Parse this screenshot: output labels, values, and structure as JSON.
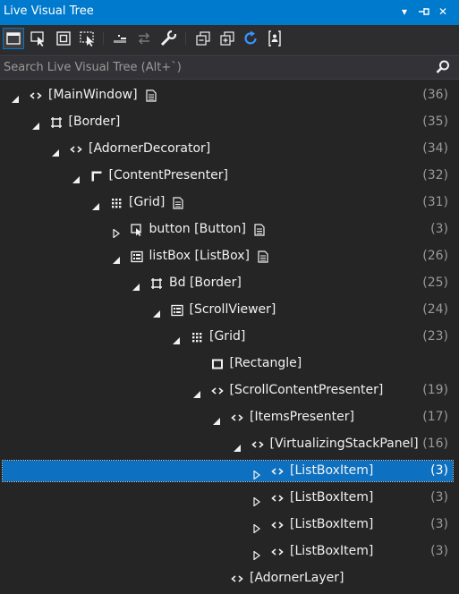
{
  "panel": {
    "title": "Live Visual Tree",
    "colors": {
      "accent": "#007acc",
      "background": "#252526",
      "selected": "#0e70c0",
      "count": "#9a9a9a"
    }
  },
  "titlebar_buttons": [
    {
      "name": "dropdown-icon",
      "glyph": "▾"
    },
    {
      "name": "pin-icon",
      "glyph": "⊣"
    },
    {
      "name": "close-icon",
      "glyph": "✕"
    }
  ],
  "toolbar": [
    {
      "name": "select-in-running-app-icon"
    },
    {
      "name": "select-element-icon"
    },
    {
      "name": "display-layout-adorners-icon"
    },
    {
      "name": "track-focused-element-icon"
    },
    {
      "name": "go-to-live-visual-tree-icon"
    },
    {
      "name": "back-to-source-icon"
    },
    {
      "name": "show-properties-icon"
    },
    {
      "name": "collapse-all-icon"
    },
    {
      "name": "expand-all-icon"
    },
    {
      "name": "refresh-icon"
    },
    {
      "name": "show-just-my-xaml-icon"
    }
  ],
  "search": {
    "placeholder": "Search Live Visual Tree (Alt+`)"
  },
  "tree": [
    {
      "label": "[MainWindow]",
      "count": "(36)",
      "level": 0,
      "expander": "expanded",
      "icon": "code",
      "doc": true
    },
    {
      "label": "[Border]",
      "count": "(35)",
      "level": 1,
      "expander": "expanded",
      "icon": "border",
      "doc": false
    },
    {
      "label": "[AdornerDecorator]",
      "count": "(34)",
      "level": 2,
      "expander": "expanded",
      "icon": "code",
      "doc": false
    },
    {
      "label": "[ContentPresenter]",
      "count": "(32)",
      "level": 3,
      "expander": "expanded",
      "icon": "content",
      "doc": false
    },
    {
      "label": "[Grid]",
      "count": "(31)",
      "level": 4,
      "expander": "expanded",
      "icon": "grid",
      "doc": true
    },
    {
      "label": "button [Button]",
      "count": "(3)",
      "level": 5,
      "expander": "collapsed",
      "icon": "button",
      "doc": true
    },
    {
      "label": "listBox [ListBox]",
      "count": "(26)",
      "level": 5,
      "expander": "expanded",
      "icon": "listbox",
      "doc": true
    },
    {
      "label": "Bd [Border]",
      "count": "(25)",
      "level": 6,
      "expander": "expanded",
      "icon": "border",
      "doc": false
    },
    {
      "label": "[ScrollViewer]",
      "count": "(24)",
      "level": 7,
      "expander": "expanded",
      "icon": "listbox",
      "doc": false
    },
    {
      "label": "[Grid]",
      "count": "(23)",
      "level": 8,
      "expander": "expanded",
      "icon": "grid",
      "doc": false
    },
    {
      "label": "[Rectangle]",
      "count": "",
      "level": 9,
      "expander": "none",
      "icon": "rect",
      "doc": false
    },
    {
      "label": "[ScrollContentPresenter]",
      "count": "(19)",
      "level": 9,
      "expander": "expanded",
      "icon": "code",
      "doc": false
    },
    {
      "label": "[ItemsPresenter]",
      "count": "(17)",
      "level": 10,
      "expander": "expanded",
      "icon": "code",
      "doc": false
    },
    {
      "label": "[VirtualizingStackPanel]",
      "count": "(16)",
      "level": 11,
      "expander": "expanded",
      "icon": "code",
      "doc": false
    },
    {
      "label": "[ListBoxItem]",
      "count": "(3)",
      "level": 12,
      "expander": "collapsed",
      "icon": "code",
      "doc": false,
      "selected": true
    },
    {
      "label": "[ListBoxItem]",
      "count": "(3)",
      "level": 12,
      "expander": "collapsed",
      "icon": "code",
      "doc": false
    },
    {
      "label": "[ListBoxItem]",
      "count": "(3)",
      "level": 12,
      "expander": "collapsed",
      "icon": "code",
      "doc": false
    },
    {
      "label": "[ListBoxItem]",
      "count": "(3)",
      "level": 12,
      "expander": "collapsed",
      "icon": "code",
      "doc": false
    },
    {
      "label": "[AdornerLayer]",
      "count": "",
      "level": 10,
      "expander": "none",
      "icon": "code",
      "doc": false
    }
  ]
}
